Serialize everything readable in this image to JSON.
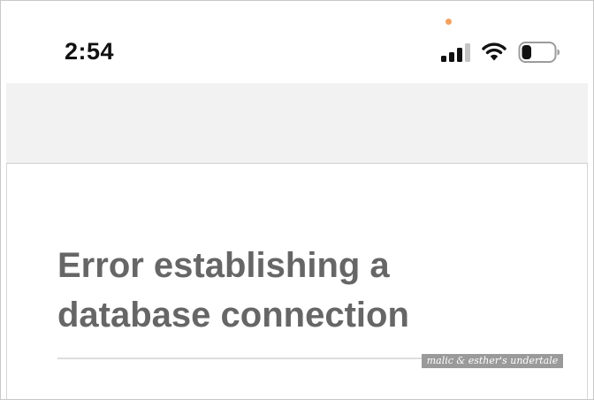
{
  "status_bar": {
    "time": "2:54",
    "privacy_indicator_color": "#f4a261",
    "signal_bars_active": 3,
    "signal_bars_total": 4,
    "wifi_icon": "wifi-icon",
    "battery_icon": "battery-icon",
    "battery_level_fraction": 0.3
  },
  "page": {
    "error_title": "Error establishing a database connection",
    "text_color": "#666666"
  },
  "watermark": {
    "text": "malic & esther's undertale"
  },
  "colors": {
    "toolbar_band": "#f2f2f2",
    "signal_active": "#111111",
    "signal_inactive": "#c4c4c4"
  }
}
